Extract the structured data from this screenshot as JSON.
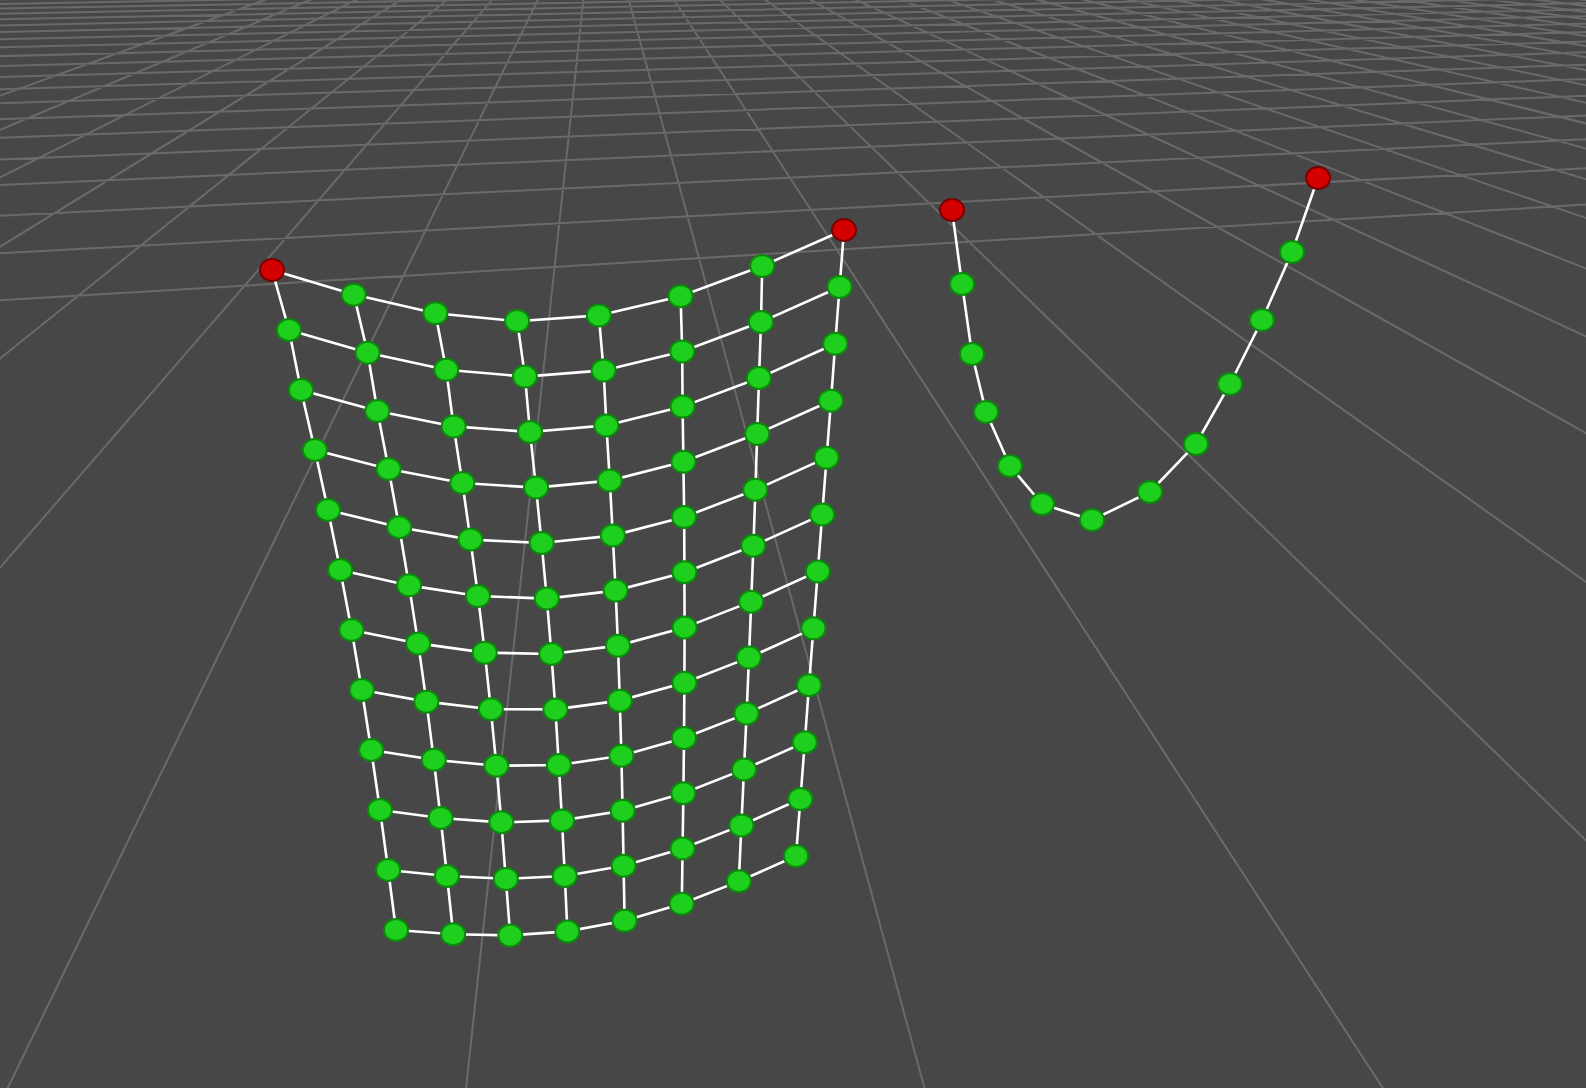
{
  "viewport": {
    "grid": true
  },
  "objects": [
    {
      "kind": "cloth",
      "pinned": true
    },
    {
      "kind": "rope",
      "pinned": true
    }
  ]
}
